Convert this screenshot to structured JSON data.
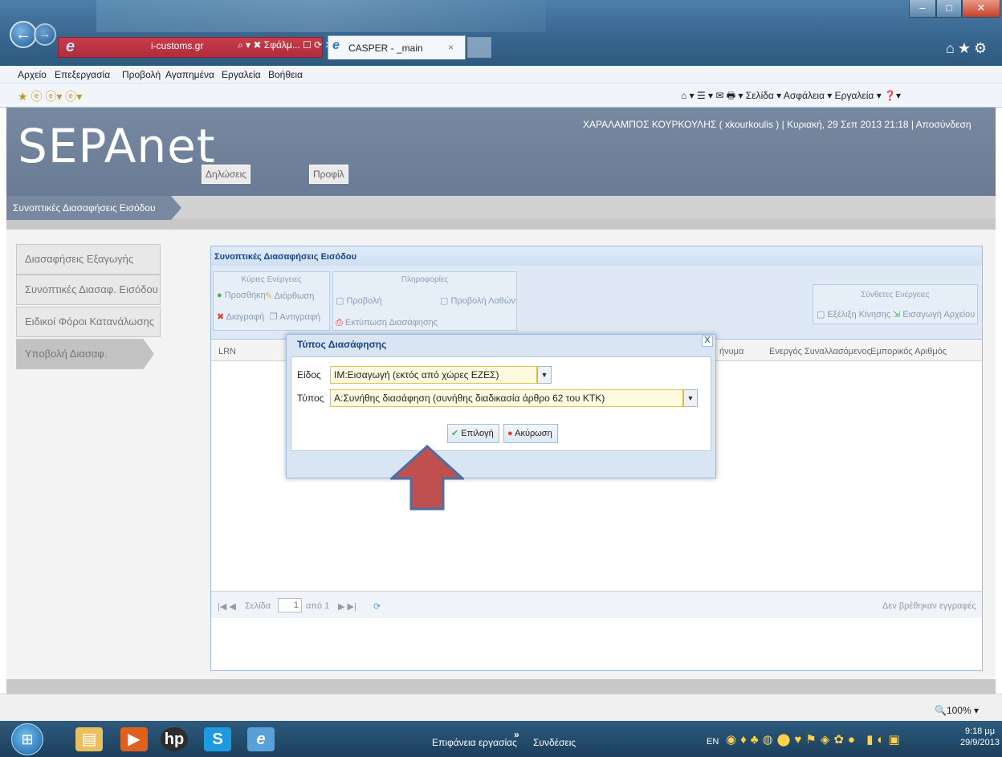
{
  "browser": {
    "address_url": "i-customs.gr",
    "address_tools": "⌕ ▾ ✖ Σφάλμ... ☐ ⟳ ✕",
    "tab_title": "CASPER - _main",
    "tab_close": "×",
    "menu": [
      "Αρχείο",
      "Επεξεργασία",
      "Προβολή",
      "Αγαπημένα",
      "Εργαλεία",
      "Βοήθεια"
    ],
    "command_bar": "⌂ ▾  ☰ ▾  ✉  🖶 ▾  Σελίδα ▾  Ασφάλεια ▾  Εργαλεία ▾  ❓▾",
    "zoom": "🔍100%  ▾"
  },
  "app": {
    "logo": "SEPAnet",
    "header_tabs": [
      "Δηλώσεις",
      "Προφίλ"
    ],
    "user_info": "ΧΑΡΑΛΑΜΠΟΣ ΚΟΥΡΚΟΥΛΗΣ ( xkourkoulis ) | Κυριακή, 29 Σεπ 2013 21:18 | Αποσύνδεση",
    "breadcrumb": "Συνοπτικές Διασαφήσεις Εισόδου",
    "sidebar": [
      {
        "label": "Διασαφήσεις Εξαγωγής"
      },
      {
        "label": "Συνοπτικές Διασαφ. Εισόδου"
      },
      {
        "label": "Ειδικοί Φόροι Κατανάλωσης"
      },
      {
        "label": "Υποβολή Διασαφ. Εισαγωγής"
      }
    ]
  },
  "panel": {
    "title": "Συνοπτικές Διασαφήσεις Εισόδου",
    "groups": {
      "main_title": "Κύριες Ενέργειες",
      "info_title": "Πληροφορίες",
      "complex_title": "Σύνθετες Ενέργειες"
    },
    "buttons": {
      "add": "Προσθήκη",
      "edit": "Διόρθωση",
      "delete": "Διαγραφή",
      "copy": "Αντιγραφή",
      "view": "Προβολή",
      "view_errors": "Προβολή Λαθών",
      "print": "Εκτύπωση Διασάφησης",
      "movement": "Εξέλιξη Κίνησης",
      "import_file": "Εισαγωγή Αρχείου"
    },
    "columns": [
      "LRN",
      "ήνυμα",
      "Ενεργός Συναλλασόμενος",
      "Εμπορικός Αριθμός"
    ],
    "pager": {
      "page_label": "Σελίδα",
      "page_value": "1",
      "of_label": "από 1",
      "empty_text": "Δεν βρέθηκαν εγγραφές"
    }
  },
  "dialog": {
    "title": "Τύπος Διασάφησης",
    "close": "X",
    "eidos_label": "Είδος",
    "eidos_value": "IM:Εισαγωγή (εκτός από χώρες ΕΖΕΣ)",
    "typos_label": "Τύπος",
    "typos_value": "A:Συνήθης διασάφηση (συνήθης διαδικασία άρθρο 62 του ΚΤΚ)",
    "ok_button": "Επιλογή",
    "cancel_button": "Ακύρωση"
  },
  "taskbar": {
    "desktop": "Επιφάνεια εργασίας",
    "chevron": "»",
    "connections": "Συνδέσεις",
    "lang": "EN",
    "time": "9:18 μμ",
    "date": "29/9/2013"
  },
  "colors": {
    "header_bg": "#7788a0",
    "accent_arrow": "#c0504d",
    "arrow_outline": "#4a6fa5",
    "panel_header_text": "#15428b"
  }
}
